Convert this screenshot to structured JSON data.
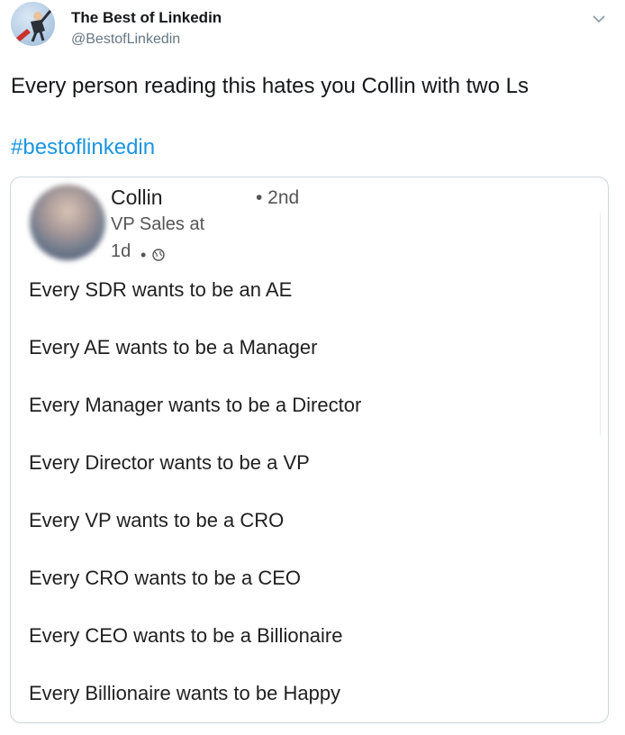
{
  "tweet": {
    "author_name": "The Best of Linkedin",
    "author_handle": "@BestofLinkedin",
    "text": "Every person reading this hates you Collin with two Ls",
    "hashtag": "#bestoflinkedin",
    "avatar_icon": "businessman-avatar",
    "menu_icon": "chevron-down-icon"
  },
  "linkedin_post": {
    "name": "Collin",
    "degree": "• 2nd",
    "title": "VP Sales at",
    "time": "1d",
    "time_separator": "•",
    "visibility_icon": "globe-icon",
    "lines": [
      "Every SDR wants to be an AE",
      "Every AE wants to be a Manager",
      "Every Manager wants to be a Director",
      "Every Director wants to be a VP",
      "Every VP wants to be a CRO",
      "Every CRO wants to be a CEO",
      "Every CEO wants to be a Billionaire",
      "Every Billionaire wants to be Happy"
    ]
  },
  "colors": {
    "text": "#14171a",
    "secondary": "#657786",
    "link": "#1b95e0",
    "border": "#ccd6dd"
  }
}
